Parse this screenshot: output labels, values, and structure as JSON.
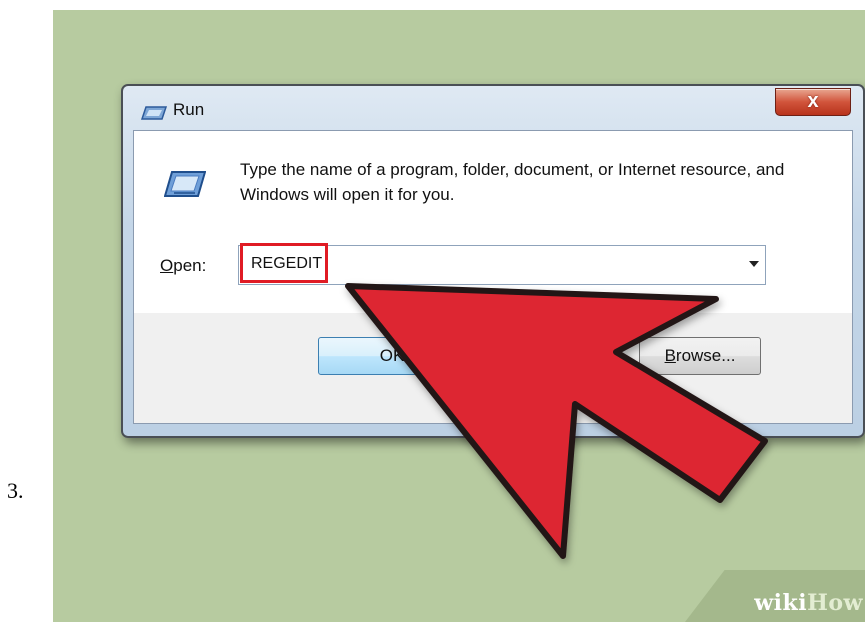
{
  "step": {
    "number": "3."
  },
  "dialog": {
    "title": "Run",
    "close_label": "x",
    "description": "Type the name of a program, folder, document, or Internet resource, and Windows will open it for you.",
    "open_label_mnemonic": "O",
    "open_label_rest": "pen:",
    "open_value": "REGEDIT",
    "ok_label": "OK",
    "browse_mnemonic": "B",
    "browse_rest": "rowse..."
  },
  "annotation": {
    "highlight_color": "#e01b24",
    "arrow_color": "#dd2632",
    "arrow_direction": "up-left"
  },
  "watermark": {
    "wiki": "wiki",
    "how": "How"
  },
  "colors": {
    "background": "#b7cba0"
  }
}
